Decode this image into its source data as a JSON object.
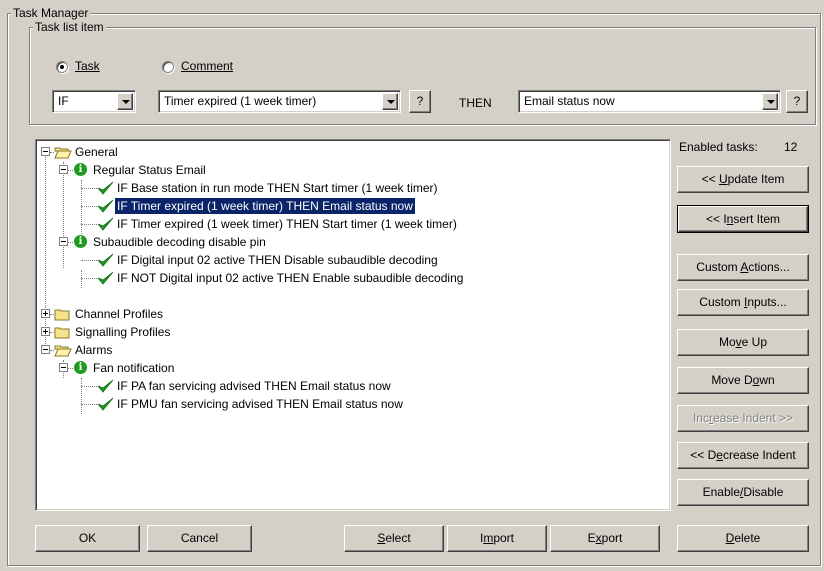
{
  "window": {
    "group_title": "Task Manager"
  },
  "task_item": {
    "group_title": "Task list item",
    "radio_task": "Task",
    "radio_comment": "Comment",
    "if_value": "IF",
    "condition_value": "Timer expired (1 week timer)",
    "help_label": "?",
    "then_label": "THEN",
    "action_value": "Email status now"
  },
  "tree": {
    "general": "General",
    "regular_status_email": "Regular Status Email",
    "task_1": "IF Base station in run mode THEN Start timer (1 week timer)",
    "task_2": "IF Timer expired (1 week timer) THEN Email status now",
    "task_3": "IF Timer expired (1 week timer) THEN Start timer (1 week timer)",
    "subaudible_pin": "Subaudible decoding disable pin",
    "task_4": "IF Digital input 02 active THEN Disable subaudible decoding",
    "task_5": "IF NOT Digital input 02 active THEN Enable subaudible decoding",
    "channel_profiles": "Channel Profiles",
    "signalling_profiles": "Signalling Profiles",
    "alarms": "Alarms",
    "fan_notification": "Fan notification",
    "task_6": "IF PA fan servicing advised THEN Email status now",
    "task_7": "IF PMU fan servicing advised THEN Email status now"
  },
  "side": {
    "enabled_label": "Enabled tasks:",
    "enabled_count": "12",
    "update_prefix": "<< ",
    "update_u": "U",
    "update_rest": "pdate Item",
    "insert_prefix": "<< I",
    "insert_u": "n",
    "insert_rest": "sert Item",
    "custom_actions_pre": "Custom ",
    "custom_actions_u": "A",
    "custom_actions_rest": "ctions...",
    "custom_inputs_pre": "Custom ",
    "custom_inputs_u": "I",
    "custom_inputs_rest": "nputs...",
    "move_up_pre": "Mo",
    "move_up_u": "v",
    "move_up_rest": "e Up",
    "move_down_pre": "Move D",
    "move_down_u": "o",
    "move_down_rest": "wn",
    "increase_pre": "Inc",
    "increase_u": "r",
    "increase_rest": "ease Indent >>",
    "decrease_pre": "<< D",
    "decrease_u": "e",
    "decrease_rest": "crease Indent",
    "enable_pre": "Enable",
    "enable_u": "/",
    "enable_rest": "Disable"
  },
  "bottom": {
    "ok": "OK",
    "cancel": "Cancel",
    "select_u": "S",
    "select_rest": "elect",
    "import_pre": "I",
    "import_u": "m",
    "import_rest": "port",
    "export_pre": "E",
    "export_u": "x",
    "export_rest": "port",
    "delete_u": "D",
    "delete_rest": "elete"
  },
  "colors": {
    "face": "#d4d0c8",
    "selection": "#0a246a",
    "check": "#1e9a1e"
  }
}
